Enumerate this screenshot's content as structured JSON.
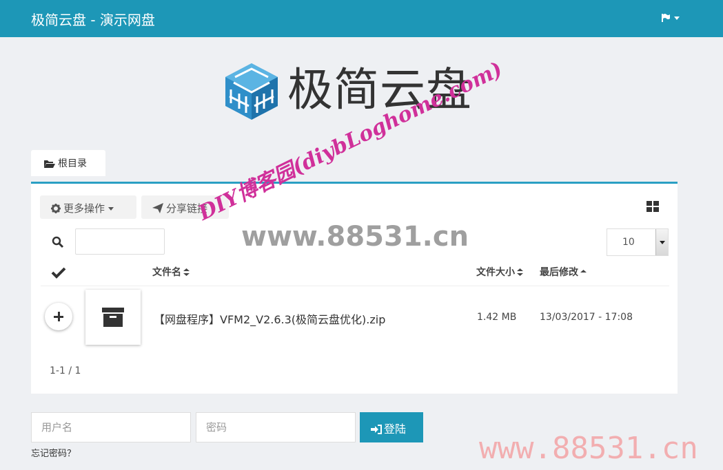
{
  "navbar": {
    "title": "极简云盘 - 演示网盘"
  },
  "logo": {
    "text": "极简云盘"
  },
  "breadcrumb": {
    "root": "根目录"
  },
  "toolbar": {
    "more_actions": "更多操作",
    "share_link": "分享链接"
  },
  "search": {
    "value": ""
  },
  "per_page": {
    "value": "10"
  },
  "table": {
    "col_name": "文件名",
    "col_size": "文件大小",
    "col_modified": "最后修改",
    "rows": [
      {
        "name": "【网盘程序】VFM2_V2.6.3(极简云盘优化).zip",
        "size": "1.42 MB",
        "modified": "13/03/2017 - 17:08"
      }
    ]
  },
  "pagination": {
    "info": "1-1 / 1"
  },
  "login": {
    "username_placeholder": "用户名",
    "password_placeholder": "密码",
    "submit": "登陆",
    "forgot": "忘记密码？"
  },
  "watermarks": {
    "slanted": "DIY博客园(diybLoghome.com)",
    "center": "www.88531.cn",
    "corner": "www.88531.cn"
  },
  "colors": {
    "primary": "#1d97b7",
    "panel_top_border": "#2a9fc3",
    "background": "#eef0f3",
    "watermark_pink": "#d0309a"
  }
}
